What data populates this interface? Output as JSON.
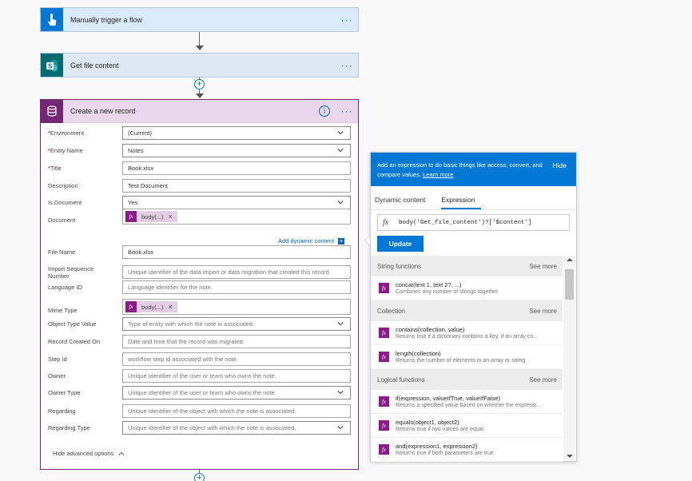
{
  "flow": {
    "trigger": {
      "title": "Manually trigger a flow",
      "menu": "···"
    },
    "get_file": {
      "title": "Get file content",
      "menu": "···"
    },
    "create": {
      "title": "Create a new record",
      "info": "i",
      "menu": "···",
      "add_dynamic_label": "Add dynamic content",
      "add_dynamic_icon": "+",
      "hide_advanced": "Hide advanced options",
      "fields": {
        "environment": {
          "label": "Environment",
          "value": "(Current)"
        },
        "entity_name": {
          "label": "Entity Name",
          "value": "Notes"
        },
        "title": {
          "label": "Title",
          "value": "Book.xlsx"
        },
        "description": {
          "label": "Description",
          "value": "Test Document"
        },
        "is_document": {
          "label": "Is Document",
          "value": "Yes"
        },
        "document": {
          "label": "Document",
          "token": "body(...)",
          "token_remove": "×"
        },
        "file_name": {
          "label": "File Name",
          "value": "Book.xlsx"
        },
        "import_seq": {
          "label": "Import Sequence Number",
          "placeholder": "Unique identifier of the data import or data migration that created this record"
        },
        "language_id": {
          "label": "Language ID",
          "placeholder": "Language identifier for the note."
        },
        "mime_type": {
          "label": "Mime Type",
          "token": "body(...)",
          "token_remove": "×"
        },
        "object_type": {
          "label": "Object Type Value",
          "placeholder": "Type of entity with which the note is associated."
        },
        "record_created": {
          "label": "Record Created On",
          "placeholder": "Date and time that the record was migrated."
        },
        "step_id": {
          "label": "Step Id",
          "placeholder": "workflow step id associated with the note."
        },
        "owner": {
          "label": "Owner",
          "placeholder": "Unique identifier of the user or team who owns the note."
        },
        "owner_type": {
          "label": "Owner Type",
          "placeholder": "Unique identifier of the user or team who owns the note."
        },
        "regarding": {
          "label": "Regarding",
          "placeholder": "Unique identifier of the object with which the note is associated."
        },
        "regarding_type": {
          "label": "Regarding Type",
          "placeholder": "Unique identifier of the object with which the note is associated."
        }
      },
      "required_mark": "*"
    }
  },
  "panel": {
    "description": "Add an expression to do basic things like access, convert, and compare values.",
    "learn_more": "Learn more",
    "hide": "Hide",
    "tabs": [
      "Dynamic content",
      "Expression"
    ],
    "fx": "fx",
    "expression_value": "body('Get_file_content')?['$content']",
    "update_button": "Update",
    "groups": [
      {
        "name": "String functions",
        "more": "See more",
        "items": [
          {
            "name": "concat(text 1, text 2?, ...)",
            "desc": "Combines any number of strings together"
          }
        ]
      },
      {
        "name": "Collection",
        "more": "See more",
        "items": [
          {
            "name": "contains(collection, value)",
            "desc": "Returns true if a dictionary contains a key, if an array co..."
          },
          {
            "name": "length(collection)",
            "desc": "Returns the number of elements in an array or string"
          }
        ]
      },
      {
        "name": "Logical functions",
        "more": "See more",
        "items": [
          {
            "name": "if(expression, valueIfTrue, valueIfFalse)",
            "desc": "Returns a specified value based on whether the expressi..."
          },
          {
            "name": "equals(object1, object2)",
            "desc": "Returns true if two values are equal"
          },
          {
            "name": "and(expression1, expression2)",
            "desc": "Returns true if both parameters are true"
          }
        ]
      }
    ]
  },
  "connector_plus": "+",
  "colors": {
    "accent": "#0078d4",
    "dataverse": "#742774",
    "sharepoint": "#036c70"
  }
}
